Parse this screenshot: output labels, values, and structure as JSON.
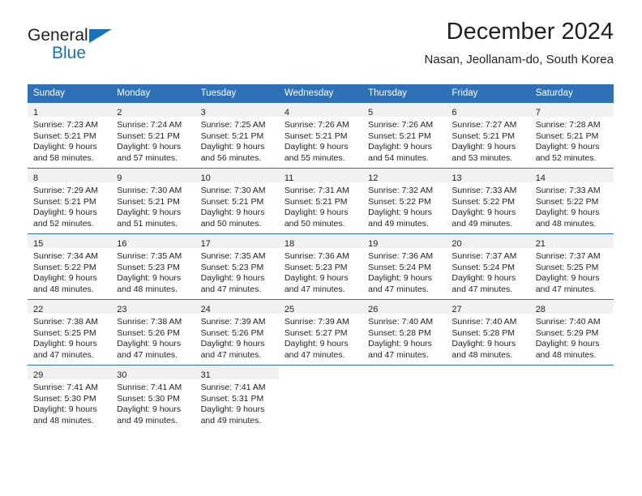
{
  "brand": {
    "name_part1": "General",
    "name_part2": "Blue",
    "accent_color": "#1772bb",
    "triangle_icon": "triangle-icon"
  },
  "header": {
    "title": "December 2024",
    "subtitle": "Nasan, Jeollanam-do, South Korea"
  },
  "calendar": {
    "header_color": "#2e71b8",
    "daynum_band_color": "#f1f1f1",
    "weekday_headers": [
      "Sunday",
      "Monday",
      "Tuesday",
      "Wednesday",
      "Thursday",
      "Friday",
      "Saturday"
    ],
    "weeks": [
      [
        {
          "day": "1",
          "sunrise": "Sunrise: 7:23 AM",
          "sunset": "Sunset: 5:21 PM",
          "daylight_line1": "Daylight: 9 hours",
          "daylight_line2": "and 58 minutes."
        },
        {
          "day": "2",
          "sunrise": "Sunrise: 7:24 AM",
          "sunset": "Sunset: 5:21 PM",
          "daylight_line1": "Daylight: 9 hours",
          "daylight_line2": "and 57 minutes."
        },
        {
          "day": "3",
          "sunrise": "Sunrise: 7:25 AM",
          "sunset": "Sunset: 5:21 PM",
          "daylight_line1": "Daylight: 9 hours",
          "daylight_line2": "and 56 minutes."
        },
        {
          "day": "4",
          "sunrise": "Sunrise: 7:26 AM",
          "sunset": "Sunset: 5:21 PM",
          "daylight_line1": "Daylight: 9 hours",
          "daylight_line2": "and 55 minutes."
        },
        {
          "day": "5",
          "sunrise": "Sunrise: 7:26 AM",
          "sunset": "Sunset: 5:21 PM",
          "daylight_line1": "Daylight: 9 hours",
          "daylight_line2": "and 54 minutes."
        },
        {
          "day": "6",
          "sunrise": "Sunrise: 7:27 AM",
          "sunset": "Sunset: 5:21 PM",
          "daylight_line1": "Daylight: 9 hours",
          "daylight_line2": "and 53 minutes."
        },
        {
          "day": "7",
          "sunrise": "Sunrise: 7:28 AM",
          "sunset": "Sunset: 5:21 PM",
          "daylight_line1": "Daylight: 9 hours",
          "daylight_line2": "and 52 minutes."
        }
      ],
      [
        {
          "day": "8",
          "sunrise": "Sunrise: 7:29 AM",
          "sunset": "Sunset: 5:21 PM",
          "daylight_line1": "Daylight: 9 hours",
          "daylight_line2": "and 52 minutes."
        },
        {
          "day": "9",
          "sunrise": "Sunrise: 7:30 AM",
          "sunset": "Sunset: 5:21 PM",
          "daylight_line1": "Daylight: 9 hours",
          "daylight_line2": "and 51 minutes."
        },
        {
          "day": "10",
          "sunrise": "Sunrise: 7:30 AM",
          "sunset": "Sunset: 5:21 PM",
          "daylight_line1": "Daylight: 9 hours",
          "daylight_line2": "and 50 minutes."
        },
        {
          "day": "11",
          "sunrise": "Sunrise: 7:31 AM",
          "sunset": "Sunset: 5:21 PM",
          "daylight_line1": "Daylight: 9 hours",
          "daylight_line2": "and 50 minutes."
        },
        {
          "day": "12",
          "sunrise": "Sunrise: 7:32 AM",
          "sunset": "Sunset: 5:22 PM",
          "daylight_line1": "Daylight: 9 hours",
          "daylight_line2": "and 49 minutes."
        },
        {
          "day": "13",
          "sunrise": "Sunrise: 7:33 AM",
          "sunset": "Sunset: 5:22 PM",
          "daylight_line1": "Daylight: 9 hours",
          "daylight_line2": "and 49 minutes."
        },
        {
          "day": "14",
          "sunrise": "Sunrise: 7:33 AM",
          "sunset": "Sunset: 5:22 PM",
          "daylight_line1": "Daylight: 9 hours",
          "daylight_line2": "and 48 minutes."
        }
      ],
      [
        {
          "day": "15",
          "sunrise": "Sunrise: 7:34 AM",
          "sunset": "Sunset: 5:22 PM",
          "daylight_line1": "Daylight: 9 hours",
          "daylight_line2": "and 48 minutes."
        },
        {
          "day": "16",
          "sunrise": "Sunrise: 7:35 AM",
          "sunset": "Sunset: 5:23 PM",
          "daylight_line1": "Daylight: 9 hours",
          "daylight_line2": "and 48 minutes."
        },
        {
          "day": "17",
          "sunrise": "Sunrise: 7:35 AM",
          "sunset": "Sunset: 5:23 PM",
          "daylight_line1": "Daylight: 9 hours",
          "daylight_line2": "and 47 minutes."
        },
        {
          "day": "18",
          "sunrise": "Sunrise: 7:36 AM",
          "sunset": "Sunset: 5:23 PM",
          "daylight_line1": "Daylight: 9 hours",
          "daylight_line2": "and 47 minutes."
        },
        {
          "day": "19",
          "sunrise": "Sunrise: 7:36 AM",
          "sunset": "Sunset: 5:24 PM",
          "daylight_line1": "Daylight: 9 hours",
          "daylight_line2": "and 47 minutes."
        },
        {
          "day": "20",
          "sunrise": "Sunrise: 7:37 AM",
          "sunset": "Sunset: 5:24 PM",
          "daylight_line1": "Daylight: 9 hours",
          "daylight_line2": "and 47 minutes."
        },
        {
          "day": "21",
          "sunrise": "Sunrise: 7:37 AM",
          "sunset": "Sunset: 5:25 PM",
          "daylight_line1": "Daylight: 9 hours",
          "daylight_line2": "and 47 minutes."
        }
      ],
      [
        {
          "day": "22",
          "sunrise": "Sunrise: 7:38 AM",
          "sunset": "Sunset: 5:25 PM",
          "daylight_line1": "Daylight: 9 hours",
          "daylight_line2": "and 47 minutes."
        },
        {
          "day": "23",
          "sunrise": "Sunrise: 7:38 AM",
          "sunset": "Sunset: 5:26 PM",
          "daylight_line1": "Daylight: 9 hours",
          "daylight_line2": "and 47 minutes."
        },
        {
          "day": "24",
          "sunrise": "Sunrise: 7:39 AM",
          "sunset": "Sunset: 5:26 PM",
          "daylight_line1": "Daylight: 9 hours",
          "daylight_line2": "and 47 minutes."
        },
        {
          "day": "25",
          "sunrise": "Sunrise: 7:39 AM",
          "sunset": "Sunset: 5:27 PM",
          "daylight_line1": "Daylight: 9 hours",
          "daylight_line2": "and 47 minutes."
        },
        {
          "day": "26",
          "sunrise": "Sunrise: 7:40 AM",
          "sunset": "Sunset: 5:28 PM",
          "daylight_line1": "Daylight: 9 hours",
          "daylight_line2": "and 47 minutes."
        },
        {
          "day": "27",
          "sunrise": "Sunrise: 7:40 AM",
          "sunset": "Sunset: 5:28 PM",
          "daylight_line1": "Daylight: 9 hours",
          "daylight_line2": "and 48 minutes."
        },
        {
          "day": "28",
          "sunrise": "Sunrise: 7:40 AM",
          "sunset": "Sunset: 5:29 PM",
          "daylight_line1": "Daylight: 9 hours",
          "daylight_line2": "and 48 minutes."
        }
      ],
      [
        {
          "day": "29",
          "sunrise": "Sunrise: 7:41 AM",
          "sunset": "Sunset: 5:30 PM",
          "daylight_line1": "Daylight: 9 hours",
          "daylight_line2": "and 48 minutes."
        },
        {
          "day": "30",
          "sunrise": "Sunrise: 7:41 AM",
          "sunset": "Sunset: 5:30 PM",
          "daylight_line1": "Daylight: 9 hours",
          "daylight_line2": "and 49 minutes."
        },
        {
          "day": "31",
          "sunrise": "Sunrise: 7:41 AM",
          "sunset": "Sunset: 5:31 PM",
          "daylight_line1": "Daylight: 9 hours",
          "daylight_line2": "and 49 minutes."
        },
        {
          "day": "",
          "sunrise": "",
          "sunset": "",
          "daylight_line1": "",
          "daylight_line2": ""
        },
        {
          "day": "",
          "sunrise": "",
          "sunset": "",
          "daylight_line1": "",
          "daylight_line2": ""
        },
        {
          "day": "",
          "sunrise": "",
          "sunset": "",
          "daylight_line1": "",
          "daylight_line2": ""
        },
        {
          "day": "",
          "sunrise": "",
          "sunset": "",
          "daylight_line1": "",
          "daylight_line2": ""
        }
      ]
    ]
  }
}
